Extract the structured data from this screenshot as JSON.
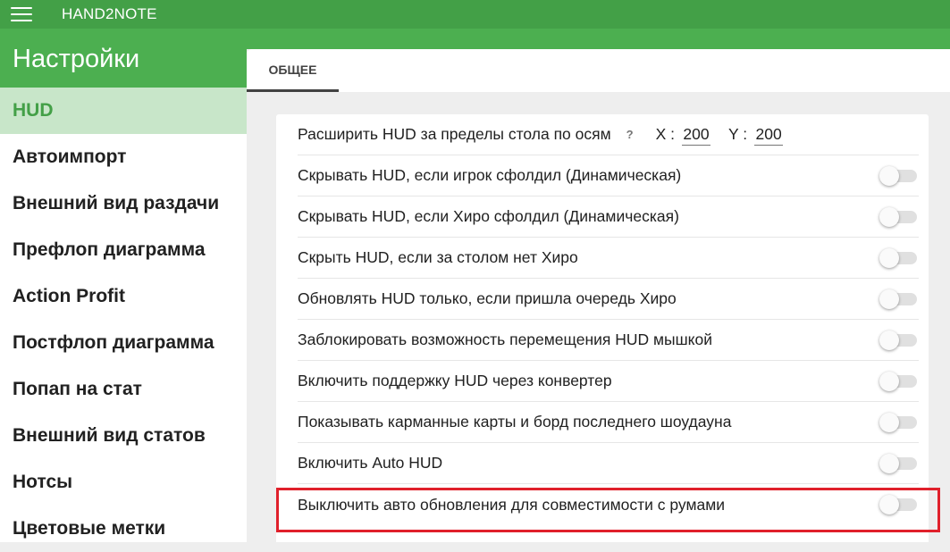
{
  "app": {
    "name": "HAND2NOTE",
    "menu_icon": "hamburger-menu-icon",
    "accent": "#43a047",
    "header_band": "#4caf50"
  },
  "page_title": "Настройки",
  "sidebar": {
    "active_bg": "#c8e6c9",
    "items": [
      {
        "label": "HUD",
        "active": true
      },
      {
        "label": "Автоимпорт"
      },
      {
        "label": "Внешний вид раздачи"
      },
      {
        "label": "Префлоп диаграмма"
      },
      {
        "label": "Action Profit"
      },
      {
        "label": "Постфлоп диаграмма"
      },
      {
        "label": "Попап на стат"
      },
      {
        "label": "Внешний вид статов"
      },
      {
        "label": "Нотсы"
      },
      {
        "label": "Цветовые метки"
      }
    ]
  },
  "tabs": [
    {
      "label": "ОБЩЕЕ",
      "active": true
    }
  ],
  "settings": {
    "extend": {
      "label": "Расширить HUD за пределы стола по осям",
      "help": "?",
      "x_label": "X :",
      "x_value": "200",
      "y_label": "Y :",
      "y_value": "200"
    },
    "toggles": [
      {
        "label": "Скрывать HUD, если игрок сфолдил (Динамическая)",
        "on": false
      },
      {
        "label": "Скрывать HUD, если Хиро сфолдил (Динамическая)",
        "on": false
      },
      {
        "label": "Скрыть HUD, если за столом нет Хиро",
        "on": false
      },
      {
        "label": "Обновлять HUD только, если пришла очередь Хиро",
        "on": false
      },
      {
        "label": "Заблокировать возможность перемещения HUD мышкой",
        "on": false
      },
      {
        "label": "Включить поддержку HUD через конвертер",
        "on": false
      },
      {
        "label": "Показывать карманные карты и борд последнего шоудауна",
        "on": false
      },
      {
        "label": "Включить Auto HUD",
        "on": false
      },
      {
        "label": "Выключить авто обновления для совместимости с румами",
        "on": false,
        "highlighted": true
      }
    ]
  },
  "highlight_color": "#e0202b"
}
